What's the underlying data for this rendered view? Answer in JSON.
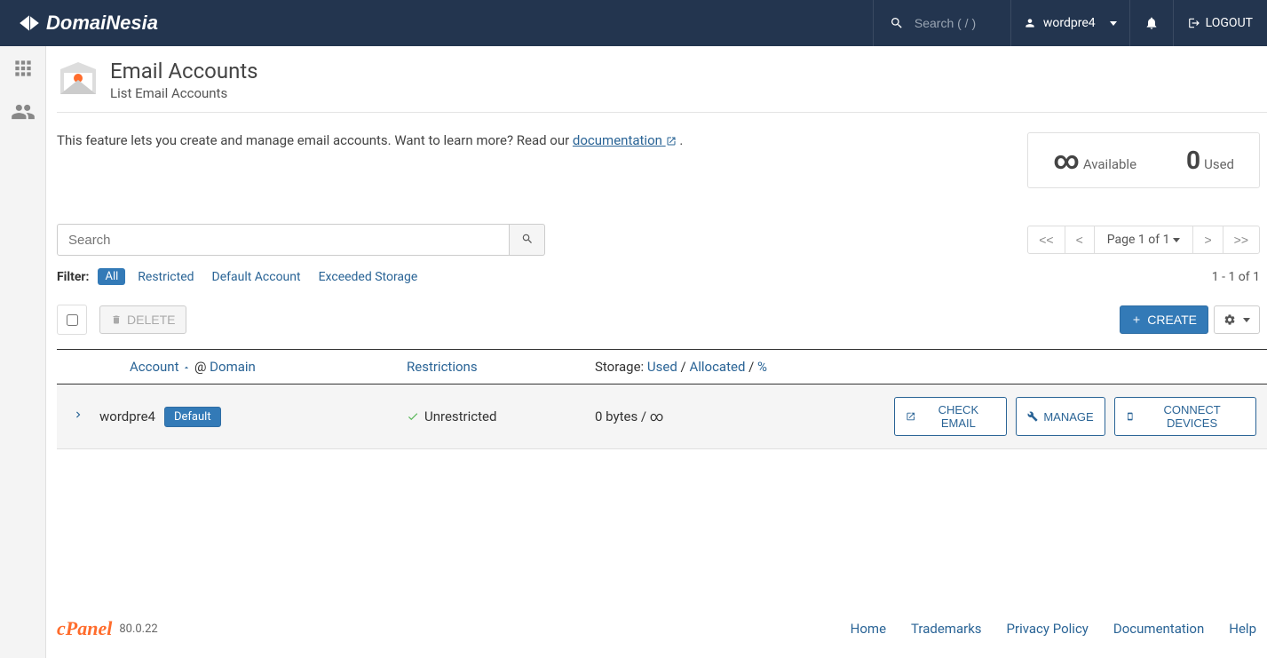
{
  "header": {
    "brand": "DomaiNesia",
    "search_placeholder": "Search ( / )",
    "username": "wordpre4",
    "logout": "LOGOUT"
  },
  "page": {
    "title": "Email Accounts",
    "subtitle": "List Email Accounts",
    "intro_pre": "This feature lets you create and manage email accounts. Want to learn more? Read our ",
    "intro_link": "documentation",
    "intro_post": " ."
  },
  "stats": {
    "available_num": "∞",
    "available_label": "Available",
    "used_num": "0",
    "used_label": "Used"
  },
  "search": {
    "placeholder": "Search"
  },
  "pager": {
    "first": "<<",
    "prev": "<",
    "mid": "Page 1 of 1",
    "next": ">",
    "last": ">>"
  },
  "filters": {
    "label": "Filter:",
    "all": "All",
    "restricted": "Restricted",
    "default_account": "Default Account",
    "exceeded": "Exceeded Storage",
    "result_count": "1 - 1 of 1"
  },
  "actions": {
    "delete": "DELETE",
    "create": "CREATE"
  },
  "columns": {
    "account": "Account",
    "at": " @ ",
    "domain": "Domain",
    "restrictions": "Restrictions",
    "storage_prefix": "Storage: ",
    "used": "Used",
    "allocated": "Allocated",
    "percent": "%",
    "sep": " / "
  },
  "row": {
    "account": "wordpre4",
    "badge": "Default",
    "restrictions": "Unrestricted",
    "storage": "0 bytes / ∞",
    "check_email": "CHECK EMAIL",
    "manage": "MANAGE",
    "connect": "CONNECT DEVICES"
  },
  "footer": {
    "brand": "cPanel",
    "version": "80.0.22",
    "links": {
      "home": "Home",
      "trademarks": "Trademarks",
      "privacy": "Privacy Policy",
      "documentation": "Documentation",
      "help": "Help"
    }
  }
}
